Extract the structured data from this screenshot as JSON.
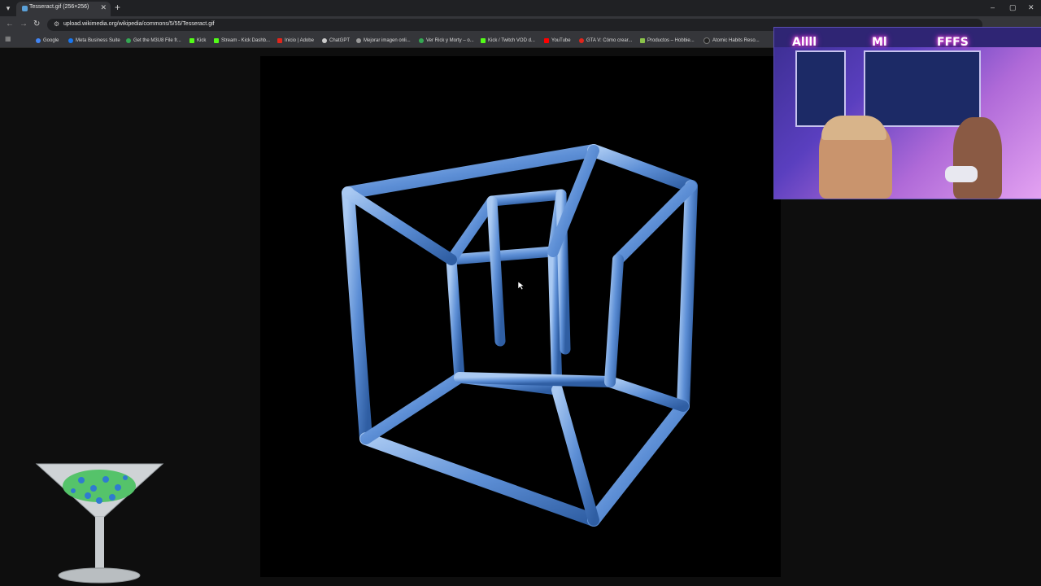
{
  "browser": {
    "tab": {
      "title": "Tesseract.gif (256×256)",
      "close": "✕"
    },
    "new_tab": "+",
    "window_controls": {
      "minimize": "–",
      "maximize": "▢",
      "close": "✕"
    },
    "nav": {
      "back": "←",
      "forward": "→",
      "reload": "↻"
    },
    "url": "upload.wikimedia.org/wikipedia/commons/5/55/Tesseract.gif"
  },
  "bookmarks": [
    {
      "label": "Google",
      "color": "#4285f4"
    },
    {
      "label": "Meta Business Suite",
      "color": "#1877f2"
    },
    {
      "label": "Get the M3U8 File fr...",
      "color": "#34a853"
    },
    {
      "label": "Kick",
      "color": "#53fc18"
    },
    {
      "label": "Stream - Kick Dashb...",
      "color": "#53fc18"
    },
    {
      "label": "Inicio | Adobe",
      "color": "#e1251b"
    },
    {
      "label": "ChatGPT",
      "color": "#cccccc"
    },
    {
      "label": "Mejorar imagen onli...",
      "color": "#999999"
    },
    {
      "label": "Ver Rick y Morty – o...",
      "color": "#34a853"
    },
    {
      "label": "Kick / Twitch VOD d...",
      "color": "#53fc18"
    },
    {
      "label": "YouTube",
      "color": "#ff0000"
    },
    {
      "label": "GTA V: Cómo crear...",
      "color": "#e1251b"
    },
    {
      "label": "Productos – Hobbie...",
      "color": "#8bc34a"
    },
    {
      "label": "Atomic Habits Reso...",
      "color": "#222222"
    }
  ],
  "webcam": {
    "neon_signs": [
      "Allll",
      "Ml",
      "FFFS"
    ]
  },
  "colors": {
    "tesseract": "#5d8fd6",
    "background": "#0e0e0e",
    "image_bg": "#000000"
  }
}
